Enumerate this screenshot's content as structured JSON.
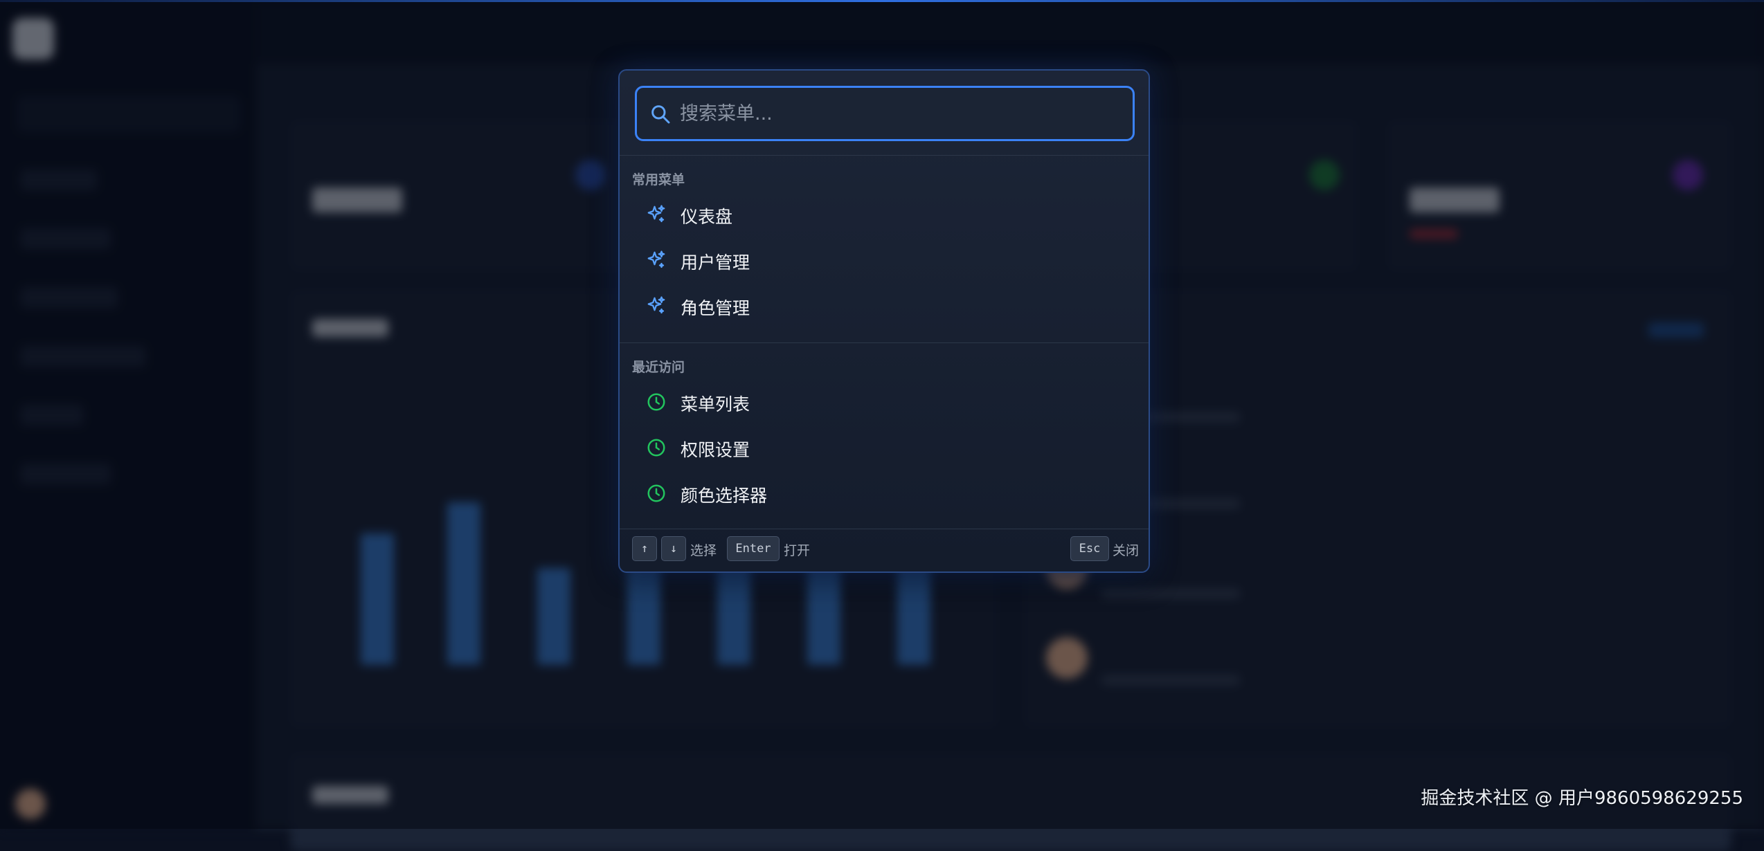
{
  "search": {
    "placeholder": "搜索菜单..."
  },
  "sections": {
    "common": {
      "title": "常用菜单",
      "items": [
        {
          "label": "仪表盘",
          "icon": "sparkle-icon"
        },
        {
          "label": "用户管理",
          "icon": "sparkle-icon"
        },
        {
          "label": "角色管理",
          "icon": "sparkle-icon"
        }
      ]
    },
    "recent": {
      "title": "最近访问",
      "items": [
        {
          "label": "菜单列表",
          "icon": "clock-icon"
        },
        {
          "label": "权限设置",
          "icon": "clock-icon"
        },
        {
          "label": "颜色选择器",
          "icon": "clock-icon"
        }
      ]
    }
  },
  "footer": {
    "up_key": "↑",
    "down_key": "↓",
    "select_label": "选择",
    "enter_key": "Enter",
    "open_label": "打开",
    "esc_key": "Esc",
    "close_label": "关闭"
  },
  "watermark": "掘金技术社区 @ 用户9860598629255",
  "colors": {
    "accent": "#3b82f6",
    "common_icon": "#5aa2ff",
    "recent_icon": "#22c55e"
  }
}
